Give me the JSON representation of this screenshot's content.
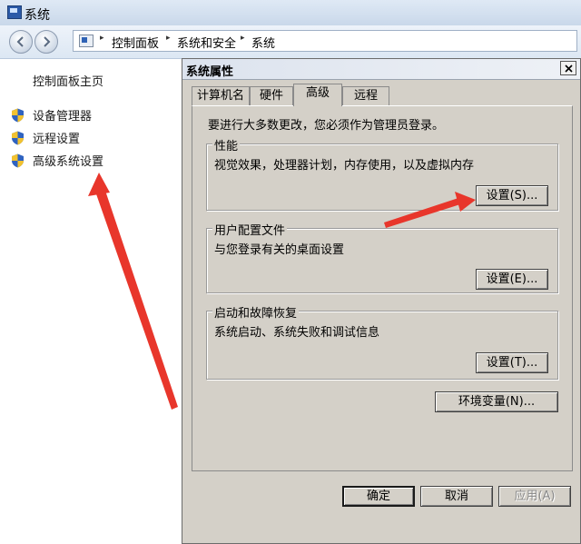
{
  "window": {
    "title": "系统"
  },
  "address_bar": {
    "crumbs": [
      "控制面板",
      "系统和安全",
      "系统"
    ]
  },
  "left_pane": {
    "home_link": "控制面板主页",
    "links": [
      "设备管理器",
      "远程设置",
      "高级系统设置"
    ]
  },
  "dialog": {
    "title": "系统属性",
    "tabs": [
      "计算机名",
      "硬件",
      "高级",
      "远程"
    ],
    "active_tab": "高级",
    "admin_note": "要进行大多数更改，您必须作为管理员登录。",
    "performance": {
      "title": "性能",
      "desc": "视觉效果，处理器计划，内存使用，以及虚拟内存",
      "button": "设置(S)..."
    },
    "user_profiles": {
      "title": "用户配置文件",
      "desc": "与您登录有关的桌面设置",
      "button": "设置(E)..."
    },
    "startup_recovery": {
      "title": "启动和故障恢复",
      "desc": "系统启动、系统失败和调试信息",
      "button": "设置(T)..."
    },
    "env_button": "环境变量(N)...",
    "ok": "确定",
    "cancel": "取消",
    "apply": "应用(A)"
  },
  "colors": {
    "annotation_arrow": "#e8362b",
    "dialog_bg": "#d4d0c8"
  }
}
